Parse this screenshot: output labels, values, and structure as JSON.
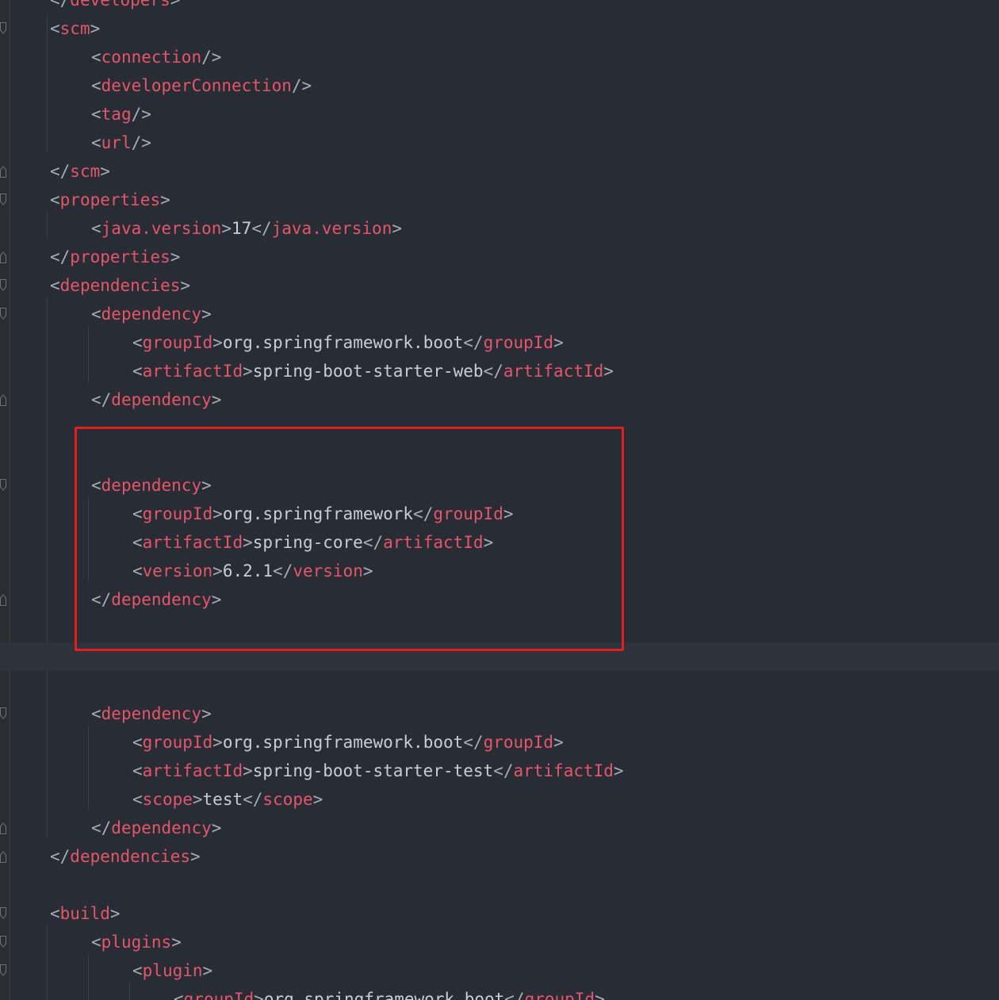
{
  "colors": {
    "background": "#282c34",
    "tag": "#e5566b",
    "bracket": "#a6acb8",
    "text": "#c8cdd6",
    "highlight_box": "#e02020"
  },
  "lines": [
    {
      "id": "l00",
      "indent": 0,
      "parts": [
        [
          "b",
          "</"
        ],
        [
          "t",
          "developers"
        ],
        [
          "b",
          ">"
        ]
      ]
    },
    {
      "id": "l01",
      "indent": 0,
      "parts": [
        [
          "b",
          "<"
        ],
        [
          "t",
          "scm"
        ],
        [
          "b",
          ">"
        ]
      ]
    },
    {
      "id": "l02",
      "indent": 1,
      "parts": [
        [
          "b",
          "<"
        ],
        [
          "t",
          "connection"
        ],
        [
          "b",
          "/>"
        ]
      ]
    },
    {
      "id": "l03",
      "indent": 1,
      "parts": [
        [
          "b",
          "<"
        ],
        [
          "t",
          "developerConnection"
        ],
        [
          "b",
          "/>"
        ]
      ]
    },
    {
      "id": "l04",
      "indent": 1,
      "parts": [
        [
          "b",
          "<"
        ],
        [
          "t",
          "tag"
        ],
        [
          "b",
          "/>"
        ]
      ]
    },
    {
      "id": "l05",
      "indent": 1,
      "parts": [
        [
          "b",
          "<"
        ],
        [
          "t",
          "url"
        ],
        [
          "b",
          "/>"
        ]
      ]
    },
    {
      "id": "l06",
      "indent": 0,
      "parts": [
        [
          "b",
          "</"
        ],
        [
          "t",
          "scm"
        ],
        [
          "b",
          ">"
        ]
      ]
    },
    {
      "id": "l07",
      "indent": 0,
      "parts": [
        [
          "b",
          "<"
        ],
        [
          "t",
          "properties"
        ],
        [
          "b",
          ">"
        ]
      ]
    },
    {
      "id": "l08",
      "indent": 1,
      "parts": [
        [
          "b",
          "<"
        ],
        [
          "t",
          "java.version"
        ],
        [
          "b",
          ">"
        ],
        [
          "x",
          "17"
        ],
        [
          "b",
          "</"
        ],
        [
          "t",
          "java.version"
        ],
        [
          "b",
          ">"
        ]
      ]
    },
    {
      "id": "l09",
      "indent": 0,
      "parts": [
        [
          "b",
          "</"
        ],
        [
          "t",
          "properties"
        ],
        [
          "b",
          ">"
        ]
      ]
    },
    {
      "id": "l10",
      "indent": 0,
      "parts": [
        [
          "b",
          "<"
        ],
        [
          "t",
          "dependencies"
        ],
        [
          "b",
          ">"
        ]
      ]
    },
    {
      "id": "l11",
      "indent": 1,
      "parts": [
        [
          "b",
          "<"
        ],
        [
          "t",
          "dependency"
        ],
        [
          "b",
          ">"
        ]
      ]
    },
    {
      "id": "l12",
      "indent": 2,
      "parts": [
        [
          "b",
          "<"
        ],
        [
          "t",
          "groupId"
        ],
        [
          "b",
          ">"
        ],
        [
          "x",
          "org.springframework.boot"
        ],
        [
          "b",
          "</"
        ],
        [
          "t",
          "groupId"
        ],
        [
          "b",
          ">"
        ]
      ]
    },
    {
      "id": "l13",
      "indent": 2,
      "parts": [
        [
          "b",
          "<"
        ],
        [
          "t",
          "artifactId"
        ],
        [
          "b",
          ">"
        ],
        [
          "x",
          "spring-boot-starter-web"
        ],
        [
          "b",
          "</"
        ],
        [
          "t",
          "artifactId"
        ],
        [
          "b",
          ">"
        ]
      ]
    },
    {
      "id": "l14",
      "indent": 1,
      "parts": [
        [
          "b",
          "</"
        ],
        [
          "t",
          "dependency"
        ],
        [
          "b",
          ">"
        ]
      ]
    },
    {
      "id": "l15",
      "indent": 0,
      "parts": []
    },
    {
      "id": "l16",
      "indent": 0,
      "parts": []
    },
    {
      "id": "l17",
      "indent": 1,
      "parts": [
        [
          "b",
          "<"
        ],
        [
          "t",
          "dependency"
        ],
        [
          "b",
          ">"
        ]
      ]
    },
    {
      "id": "l18",
      "indent": 2,
      "parts": [
        [
          "b",
          "<"
        ],
        [
          "t",
          "groupId"
        ],
        [
          "b",
          ">"
        ],
        [
          "x",
          "org.springframework"
        ],
        [
          "b",
          "</"
        ],
        [
          "t",
          "groupId"
        ],
        [
          "b",
          ">"
        ]
      ]
    },
    {
      "id": "l19",
      "indent": 2,
      "parts": [
        [
          "b",
          "<"
        ],
        [
          "t",
          "artifactId"
        ],
        [
          "b",
          ">"
        ],
        [
          "x",
          "spring-core"
        ],
        [
          "b",
          "</"
        ],
        [
          "t",
          "artifactId"
        ],
        [
          "b",
          ">"
        ]
      ]
    },
    {
      "id": "l20",
      "indent": 2,
      "parts": [
        [
          "b",
          "<"
        ],
        [
          "t",
          "version"
        ],
        [
          "b",
          ">"
        ],
        [
          "x",
          "6.2.1"
        ],
        [
          "b",
          "</"
        ],
        [
          "t",
          "version"
        ],
        [
          "b",
          ">"
        ]
      ]
    },
    {
      "id": "l21",
      "indent": 1,
      "parts": [
        [
          "b",
          "</"
        ],
        [
          "t",
          "dependency"
        ],
        [
          "b",
          ">"
        ]
      ]
    },
    {
      "id": "l22",
      "indent": 0,
      "parts": []
    },
    {
      "id": "l23",
      "indent": 0,
      "parts": [],
      "current": true
    },
    {
      "id": "l24",
      "indent": 0,
      "parts": []
    },
    {
      "id": "l25",
      "indent": 1,
      "parts": [
        [
          "b",
          "<"
        ],
        [
          "t",
          "dependency"
        ],
        [
          "b",
          ">"
        ]
      ]
    },
    {
      "id": "l26",
      "indent": 2,
      "parts": [
        [
          "b",
          "<"
        ],
        [
          "t",
          "groupId"
        ],
        [
          "b",
          ">"
        ],
        [
          "x",
          "org.springframework.boot"
        ],
        [
          "b",
          "</"
        ],
        [
          "t",
          "groupId"
        ],
        [
          "b",
          ">"
        ]
      ]
    },
    {
      "id": "l27",
      "indent": 2,
      "parts": [
        [
          "b",
          "<"
        ],
        [
          "t",
          "artifactId"
        ],
        [
          "b",
          ">"
        ],
        [
          "x",
          "spring-boot-starter-test"
        ],
        [
          "b",
          "</"
        ],
        [
          "t",
          "artifactId"
        ],
        [
          "b",
          ">"
        ]
      ]
    },
    {
      "id": "l28",
      "indent": 2,
      "parts": [
        [
          "b",
          "<"
        ],
        [
          "t",
          "scope"
        ],
        [
          "b",
          ">"
        ],
        [
          "x",
          "test"
        ],
        [
          "b",
          "</"
        ],
        [
          "t",
          "scope"
        ],
        [
          "b",
          ">"
        ]
      ]
    },
    {
      "id": "l29",
      "indent": 1,
      "parts": [
        [
          "b",
          "</"
        ],
        [
          "t",
          "dependency"
        ],
        [
          "b",
          ">"
        ]
      ]
    },
    {
      "id": "l30",
      "indent": 0,
      "parts": [
        [
          "b",
          "</"
        ],
        [
          "t",
          "dependencies"
        ],
        [
          "b",
          ">"
        ]
      ]
    },
    {
      "id": "l31",
      "indent": 0,
      "parts": []
    },
    {
      "id": "l32",
      "indent": 0,
      "parts": [
        [
          "b",
          "<"
        ],
        [
          "t",
          "build"
        ],
        [
          "b",
          ">"
        ]
      ]
    },
    {
      "id": "l33",
      "indent": 1,
      "parts": [
        [
          "b",
          "<"
        ],
        [
          "t",
          "plugins"
        ],
        [
          "b",
          ">"
        ]
      ]
    },
    {
      "id": "l34",
      "indent": 2,
      "parts": [
        [
          "b",
          "<"
        ],
        [
          "t",
          "plugin"
        ],
        [
          "b",
          ">"
        ]
      ]
    },
    {
      "id": "l35",
      "indent": 3,
      "parts": [
        [
          "b",
          "<"
        ],
        [
          "t",
          "groupId"
        ],
        [
          "b",
          ">"
        ],
        [
          "x",
          "org.springframework.boot"
        ],
        [
          "b",
          "</"
        ],
        [
          "t",
          "groupId"
        ],
        [
          "b",
          ">"
        ]
      ]
    }
  ],
  "fold_markers": [
    {
      "line": 1,
      "kind": "open"
    },
    {
      "line": 6,
      "kind": "close"
    },
    {
      "line": 7,
      "kind": "open"
    },
    {
      "line": 9,
      "kind": "close"
    },
    {
      "line": 10,
      "kind": "open"
    },
    {
      "line": 11,
      "kind": "open"
    },
    {
      "line": 14,
      "kind": "close"
    },
    {
      "line": 17,
      "kind": "open"
    },
    {
      "line": 21,
      "kind": "close"
    },
    {
      "line": 25,
      "kind": "open"
    },
    {
      "line": 29,
      "kind": "close"
    },
    {
      "line": 30,
      "kind": "close"
    },
    {
      "line": 32,
      "kind": "open"
    },
    {
      "line": 33,
      "kind": "open"
    },
    {
      "line": 34,
      "kind": "open"
    }
  ]
}
